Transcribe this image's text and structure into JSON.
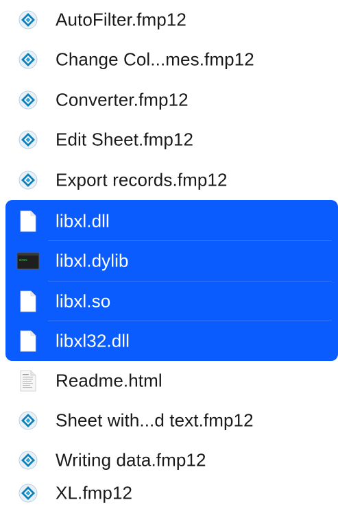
{
  "files": [
    {
      "name": "AutoFilter.fmp12",
      "icon": "filemaker-icon",
      "selected": false
    },
    {
      "name": "Change Col...mes.fmp12",
      "icon": "filemaker-icon",
      "selected": false
    },
    {
      "name": "Converter.fmp12",
      "icon": "filemaker-icon",
      "selected": false
    },
    {
      "name": "Edit Sheet.fmp12",
      "icon": "filemaker-icon",
      "selected": false
    },
    {
      "name": "Export records.fmp12",
      "icon": "filemaker-icon",
      "selected": false
    },
    {
      "name": "libxl.dll",
      "icon": "blank-document-icon",
      "selected": true
    },
    {
      "name": "libxl.dylib",
      "icon": "terminal-executable-icon",
      "selected": true
    },
    {
      "name": "libxl.so",
      "icon": "blank-document-icon",
      "selected": true
    },
    {
      "name": "libxl32.dll",
      "icon": "blank-document-icon",
      "selected": true
    },
    {
      "name": "Readme.html",
      "icon": "html-document-icon",
      "selected": false
    },
    {
      "name": "Sheet with...d text.fmp12",
      "icon": "filemaker-icon",
      "selected": false
    },
    {
      "name": "Writing data.fmp12",
      "icon": "filemaker-icon",
      "selected": false
    },
    {
      "name": "XL.fmp12",
      "icon": "filemaker-icon",
      "selected": false
    }
  ],
  "colors": {
    "selection": "#0a5cff",
    "text": "#1a1a1a",
    "selected_text": "#ffffff"
  }
}
